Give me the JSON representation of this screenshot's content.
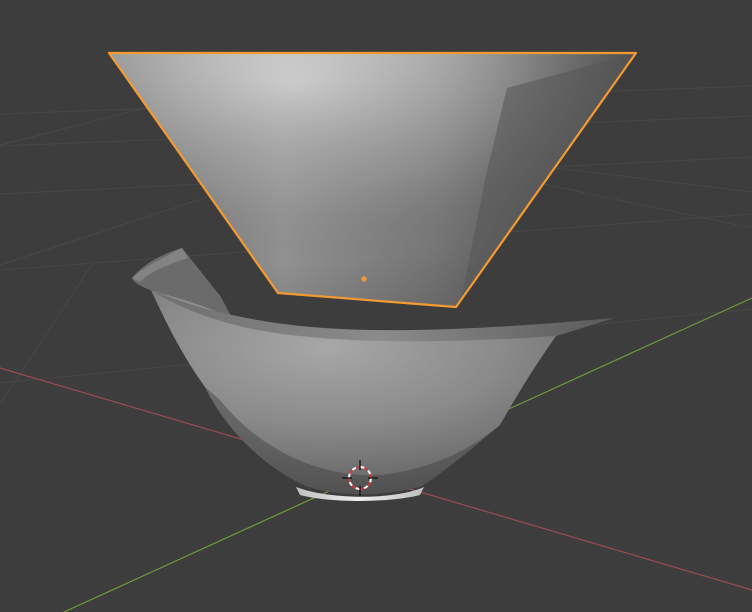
{
  "viewport": {
    "background": "#3d3d3d",
    "grid_color": "#4a4a4a",
    "x_axis_color": "#9b4a54",
    "y_axis_color": "#6f9a3b"
  },
  "objects": [
    {
      "name": "cone-object",
      "selected": true,
      "outline_color": "#f59a32"
    },
    {
      "name": "bowl-object",
      "selected": false
    }
  ],
  "origin_point": {
    "color": "#f59a32"
  },
  "cursor_3d": {
    "icon": "3d-cursor-icon",
    "colors": [
      "#ffffff",
      "#d23b3b",
      "#111111"
    ]
  }
}
